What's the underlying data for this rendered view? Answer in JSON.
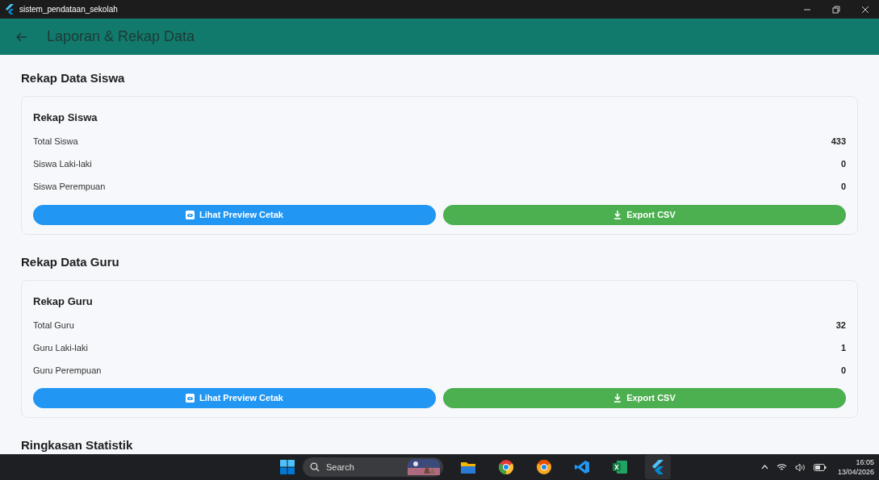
{
  "window": {
    "title": "sistem_pendataan_sekolah"
  },
  "app_bar": {
    "title": "Laporan & Rekap Data"
  },
  "sections": [
    {
      "heading": "Rekap Data Siswa",
      "card_title": "Rekap Siswa",
      "rows": [
        {
          "label": "Total Siswa",
          "value": "433"
        },
        {
          "label": "Siswa Laki-laki",
          "value": "0"
        },
        {
          "label": "Siswa Perempuan",
          "value": "0"
        }
      ],
      "buttons": [
        {
          "kind": "preview",
          "label": "Lihat Preview Cetak"
        },
        {
          "kind": "export",
          "label": "Export CSV"
        }
      ]
    },
    {
      "heading": "Rekap Data Guru",
      "card_title": "Rekap Guru",
      "rows": [
        {
          "label": "Total Guru",
          "value": "32"
        },
        {
          "label": "Guru Laki-laki",
          "value": "1"
        },
        {
          "label": "Guru Perempuan",
          "value": "0"
        }
      ],
      "buttons": [
        {
          "kind": "preview",
          "label": "Lihat Preview Cetak"
        },
        {
          "kind": "export",
          "label": "Export CSV"
        }
      ]
    },
    {
      "heading": "Ringkasan Statistik"
    }
  ],
  "taskbar": {
    "search_placeholder": "Search",
    "apps": [
      {
        "kind": "explorer"
      },
      {
        "kind": "chrome"
      },
      {
        "kind": "chrome-canary"
      },
      {
        "kind": "vscode"
      },
      {
        "kind": "excel"
      },
      {
        "kind": "flutter",
        "selected": true
      }
    ],
    "time": "16:05",
    "date": "13/04/2026"
  }
}
